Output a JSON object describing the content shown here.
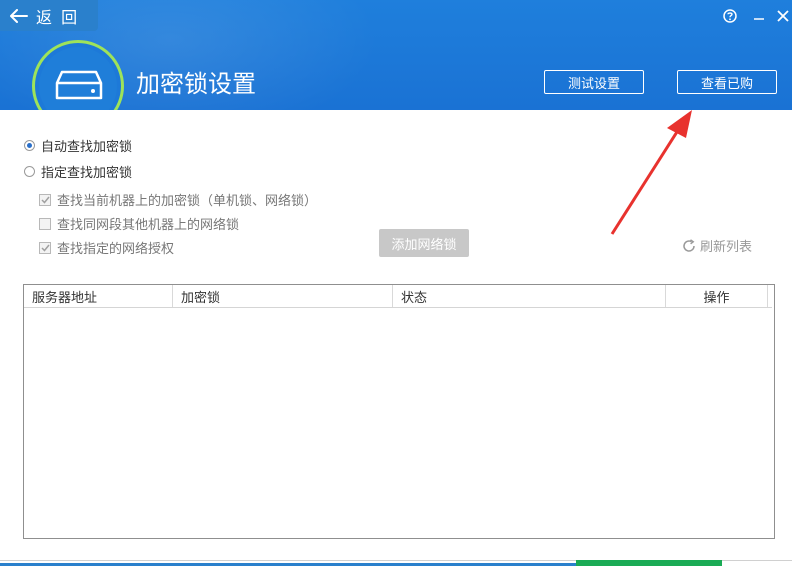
{
  "header": {
    "back_label": "返 回",
    "title": "加密锁设置",
    "test_button": "测试设置",
    "view_button": "查看已购"
  },
  "options": {
    "auto_find": "自动查找加密锁",
    "specify_find": "指定查找加密锁",
    "selected": "auto_find",
    "checks": [
      {
        "label": "查找当前机器上的加密锁（单机锁、网络锁）",
        "checked": true
      },
      {
        "label": "查找同网段其他机器上的网络锁",
        "checked": false
      },
      {
        "label": "查找指定的网络授权",
        "checked": true
      }
    ],
    "add_button": "添加网络锁",
    "refresh_label": "刷新列表"
  },
  "table": {
    "columns": [
      "服务器地址",
      "加密锁",
      "状态",
      "操作"
    ],
    "rows": []
  },
  "colors": {
    "header_blue": "#1a72d4",
    "accent_green": "#9ee35a",
    "annotation_red": "#e8322e"
  }
}
